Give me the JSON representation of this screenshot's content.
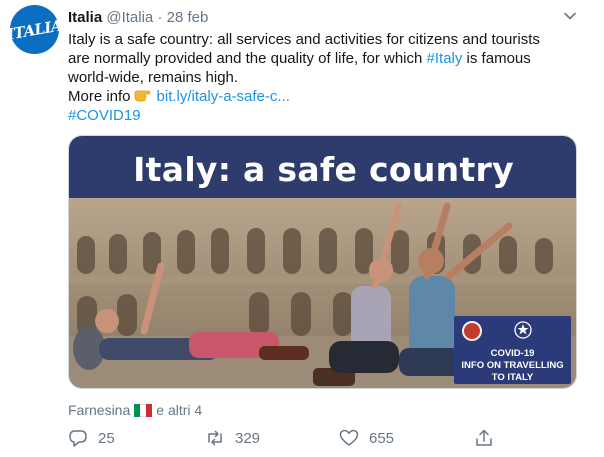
{
  "account": {
    "name": "Italia",
    "handle": "@Italia",
    "separator": "·",
    "date": "28 feb",
    "avatar_text": "ITALIA"
  },
  "tweet": {
    "line1": "Italy is a safe country: all services and activities for citizens and tourists",
    "line2_before": "are normally provided and the quality of life, for which ",
    "hashtag_italy": "#Italy",
    "line2_after": " is famous",
    "line3": "world-wide, remains high.",
    "more_info_label": "More info",
    "more_info_icon": "pointing-hand-icon",
    "link": "bit.ly/italy-a-safe-c...",
    "hashtag_covid": "#COVID19"
  },
  "card": {
    "title": "Italy: a safe country",
    "badge_line1": "COVID-19",
    "badge_line2": "INFO ON TRAVELLING",
    "badge_line3": "TO ITALY"
  },
  "liked_by": {
    "name": "Farnesina",
    "others": "e altri 4"
  },
  "actions": {
    "reply_count": "25",
    "retweet_count": "329",
    "like_count": "655"
  },
  "colors": {
    "link": "#1b95e0",
    "muted": "#657786",
    "brand_blue": "#0a6fc2",
    "badge_navy": "#2b3a78"
  }
}
